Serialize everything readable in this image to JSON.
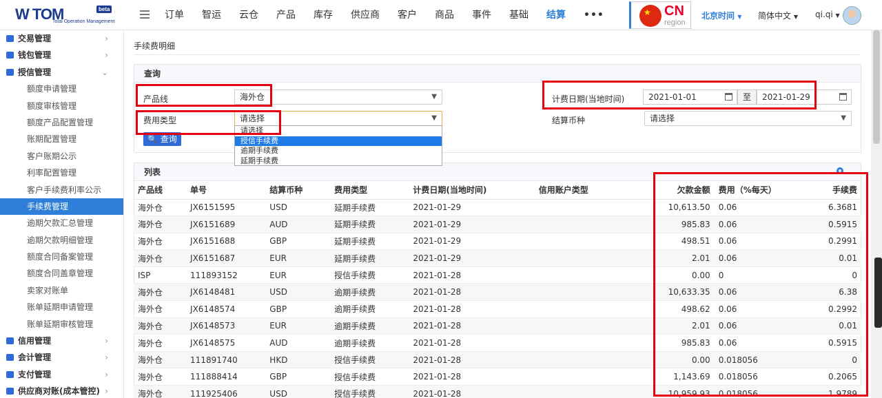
{
  "header": {
    "logo_text": "W TOM",
    "logo_badge": "beta",
    "logo_sub": "Total Operation Management",
    "nav": [
      "订单",
      "智运",
      "云仓",
      "产品",
      "库存",
      "供应商",
      "客户",
      "商品",
      "事件",
      "基础",
      "结算",
      "•••"
    ],
    "active_nav": "结算",
    "region_code": "CN",
    "region_label": "region",
    "timezone": "北京时间",
    "language": "简体中文",
    "user": "qi.qi"
  },
  "sidebar": [
    {
      "label": "交易管理",
      "type": "top",
      "arrow": "›"
    },
    {
      "label": "钱包管理",
      "type": "top",
      "arrow": "›"
    },
    {
      "label": "授信管理",
      "type": "top",
      "arrow": "⌄"
    },
    {
      "label": "额度申请管理",
      "type": "sub"
    },
    {
      "label": "额度审核管理",
      "type": "sub"
    },
    {
      "label": "额度产品配置管理",
      "type": "sub"
    },
    {
      "label": "账期配置管理",
      "type": "sub"
    },
    {
      "label": "客户账期公示",
      "type": "sub"
    },
    {
      "label": "利率配置管理",
      "type": "sub"
    },
    {
      "label": "客户手续费利率公示",
      "type": "sub"
    },
    {
      "label": "手续费管理",
      "type": "sub",
      "selected": true
    },
    {
      "label": "逾期欠款汇总管理",
      "type": "sub"
    },
    {
      "label": "逾期欠款明细管理",
      "type": "sub"
    },
    {
      "label": "额度合同备案管理",
      "type": "sub"
    },
    {
      "label": "额度合同盖章管理",
      "type": "sub"
    },
    {
      "label": "卖家对账单",
      "type": "sub"
    },
    {
      "label": "账单延期申请管理",
      "type": "sub"
    },
    {
      "label": "账单延期审核管理",
      "type": "sub"
    },
    {
      "label": "信用管理",
      "type": "top",
      "arrow": "›"
    },
    {
      "label": "会计管理",
      "type": "top",
      "arrow": "›"
    },
    {
      "label": "支付管理",
      "type": "top",
      "arrow": "›"
    },
    {
      "label": "供应商对账(成本管控)",
      "type": "top",
      "arrow": "›"
    }
  ],
  "page": {
    "breadcrumb": "手续费明细",
    "query_title": "查询",
    "product_line_label": "产品线",
    "product_line_value": "海外仓",
    "fee_type_label": "费用类型",
    "fee_type_value": "请选择",
    "fee_type_options": [
      "请选择",
      "授信手续费",
      "逾期手续费",
      "延期手续费"
    ],
    "fee_type_highlight": "授信手续费",
    "date_label": "计费日期(当地时间)",
    "date_from": "2021-01-01",
    "date_to_sep": "至",
    "date_to": "2021-01-29",
    "currency_label": "结算币种",
    "currency_value": "请选择",
    "search_button": "查询",
    "list_title": "列表"
  },
  "table": {
    "columns": [
      "产品线",
      "单号",
      "结算币种",
      "费用类型",
      "计费日期(当地时间)",
      "信用账户类型",
      "欠款金额",
      "费用（%每天）",
      "手续费"
    ],
    "rows": [
      [
        "海外仓",
        "JX6151595",
        "USD",
        "延期手续费",
        "2021-01-29",
        "",
        "10,613.50",
        "0.06",
        "6.3681"
      ],
      [
        "海外仓",
        "JX6151689",
        "AUD",
        "延期手续费",
        "2021-01-29",
        "",
        "985.83",
        "0.06",
        "0.5915"
      ],
      [
        "海外仓",
        "JX6151688",
        "GBP",
        "延期手续费",
        "2021-01-29",
        "",
        "498.51",
        "0.06",
        "0.2991"
      ],
      [
        "海外仓",
        "JX6151687",
        "EUR",
        "延期手续费",
        "2021-01-29",
        "",
        "2.01",
        "0.06",
        "0.01"
      ],
      [
        "ISP",
        "111893152",
        "EUR",
        "授信手续费",
        "2021-01-28",
        "",
        "0.00",
        "0",
        "0"
      ],
      [
        "海外仓",
        "JX6148481",
        "USD",
        "逾期手续费",
        "2021-01-28",
        "",
        "10,633.35",
        "0.06",
        "6.38"
      ],
      [
        "海外仓",
        "JX6148574",
        "GBP",
        "逾期手续费",
        "2021-01-28",
        "",
        "498.62",
        "0.06",
        "0.2992"
      ],
      [
        "海外仓",
        "JX6148573",
        "EUR",
        "逾期手续费",
        "2021-01-28",
        "",
        "2.01",
        "0.06",
        "0.01"
      ],
      [
        "海外仓",
        "JX6148575",
        "AUD",
        "逾期手续费",
        "2021-01-28",
        "",
        "985.83",
        "0.06",
        "0.5915"
      ],
      [
        "海外仓",
        "111891740",
        "HKD",
        "授信手续费",
        "2021-01-28",
        "",
        "0.00",
        "0.018056",
        "0"
      ],
      [
        "海外仓",
        "111888414",
        "GBP",
        "授信手续费",
        "2021-01-28",
        "",
        "1,143.69",
        "0.018056",
        "0.2065"
      ],
      [
        "海外仓",
        "111925406",
        "USD",
        "授信手续费",
        "2021-01-28",
        "",
        "10,959.93",
        "0.018056",
        "1.9789"
      ]
    ]
  },
  "colors": {
    "accent": "#2f7fd8",
    "highlight_box": "#e60012",
    "brand": "#1a3d8f"
  }
}
